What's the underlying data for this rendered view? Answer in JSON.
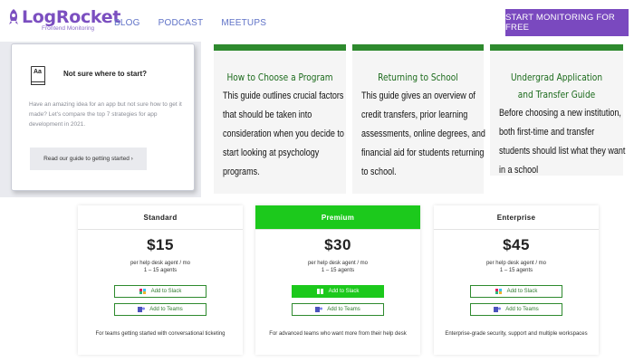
{
  "header": {
    "logo_name": "LogRocket",
    "logo_sub": "Frontend Monitoring",
    "nav": [
      "BLOG",
      "PODCAST",
      "MEETUPS"
    ],
    "cta": "START MONITORING FOR FREE"
  },
  "guide": {
    "icon_text": "Aa",
    "title": "Not sure where to start?",
    "text": "Have an amazing idea for an app but not sure how to get it made? Let's compare the top 7 strategies for app development in 2021.",
    "button": "Read our guide to getting started ›"
  },
  "articles": [
    {
      "title": "How to Choose a Program",
      "body": "This guide outlines crucial factors that should be taken into consideration when you decide to start looking at psychology programs."
    },
    {
      "title": "Returning to School",
      "body": "This guide gives an overview of credit transfers, prior learning assessments, online degrees, and financial aid for students returning to school."
    },
    {
      "title": "Undergrad Application and Transfer Guide",
      "body": "Before choosing a new institution, both first-time and transfer students should list what they want in a school"
    }
  ],
  "plans": [
    {
      "name": "Standard",
      "price": "$15",
      "unit": "per help desk agent / mo\n1 – 15 agents",
      "slack": "Add to Slack",
      "teams": "Add to Teams",
      "desc": "For teams getting started with conversational ticketing"
    },
    {
      "name": "Premium",
      "price": "$30",
      "unit": "per help desk agent / mo\n1 – 15 agents",
      "slack": "Add to Slack",
      "teams": "Add to Teams",
      "desc": "For advanced teams who want more from their help desk"
    },
    {
      "name": "Enterprise",
      "price": "$45",
      "unit": "per help desk agent / mo\n1 – 15 agents",
      "slack": "Add to Slack",
      "teams": "Add to Teams",
      "desc": "Enterprise-grade security, support and multiple workspaces"
    }
  ],
  "colors": {
    "brand_purple": "#7a49bf",
    "green_accent": "#2e8a2e",
    "premium_green": "#1cc91c"
  }
}
